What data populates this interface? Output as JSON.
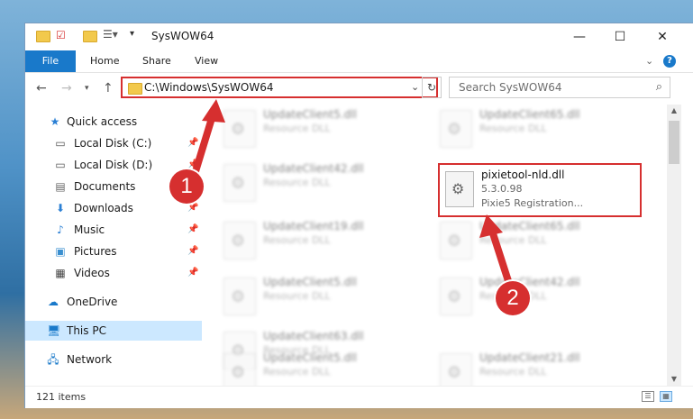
{
  "window": {
    "title": "SysWOW64"
  },
  "ribbon": {
    "file": "File",
    "tabs": [
      "Home",
      "Share",
      "View"
    ]
  },
  "address": {
    "path": "C:\\Windows\\SysWOW64"
  },
  "search": {
    "placeholder": "Search SysWOW64"
  },
  "sidebar": {
    "items": [
      {
        "label": "Quick access",
        "icon": "star-icon",
        "pinned": false
      },
      {
        "label": "Local Disk (C:)",
        "icon": "drive-icon",
        "pinned": true
      },
      {
        "label": "Local Disk (D:)",
        "icon": "drive-icon",
        "pinned": true
      },
      {
        "label": "Documents",
        "icon": "documents-icon",
        "pinned": true
      },
      {
        "label": "Downloads",
        "icon": "download-icon",
        "pinned": true
      },
      {
        "label": "Music",
        "icon": "music-icon",
        "pinned": true
      },
      {
        "label": "Pictures",
        "icon": "pictures-icon",
        "pinned": true
      },
      {
        "label": "Videos",
        "icon": "videos-icon",
        "pinned": true
      },
      {
        "label": "OneDrive",
        "icon": "cloud-icon",
        "pinned": false
      },
      {
        "label": "This PC",
        "icon": "computer-icon",
        "pinned": false
      },
      {
        "label": "Network",
        "icon": "network-icon",
        "pinned": false
      }
    ]
  },
  "files": [
    {
      "name": "UpdateClient5.dll",
      "type": "Resource DLL"
    },
    {
      "name": "UpdateClient65.dll",
      "type": "Resource DLL"
    },
    {
      "name": "UpdateClient42.dll",
      "type": "Resource DLL"
    },
    {
      "name": "UpdateClient19.dll",
      "type": "Resource DLL"
    },
    {
      "name": "UpdateClient65.dll",
      "type": "Resource DLL"
    },
    {
      "name": "UpdateClient5.dll",
      "type": "Resource DLL"
    },
    {
      "name": "UpdateClient42.dll",
      "type": "Resource DLL"
    },
    {
      "name": "UpdateClient63.dll",
      "type": "Resource DLL"
    },
    {
      "name": "UpdateClient5.dll",
      "type": "Resource DLL"
    },
    {
      "name": "UpdateClient21.dll",
      "type": "Resource DLL"
    }
  ],
  "highlighted_file": {
    "name": "pixietool-nld.dll",
    "version": "5.3.0.98",
    "description": "Pixie5 Registration..."
  },
  "status": {
    "count": "121 items"
  },
  "annotations": {
    "step1": "1",
    "step2": "2",
    "color": "#d62f2f"
  }
}
